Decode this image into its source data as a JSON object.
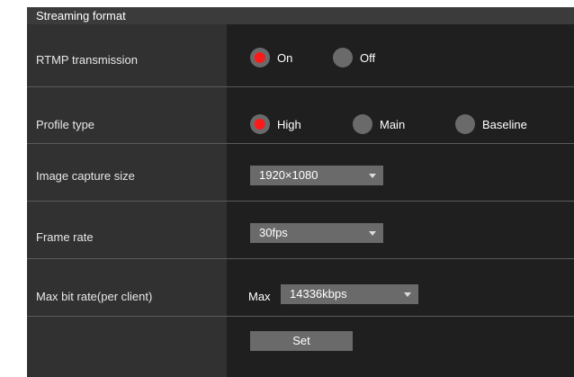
{
  "section": {
    "title": "Streaming format"
  },
  "rtmp": {
    "label": "RTMP transmission",
    "options": [
      {
        "label": "On",
        "selected": true
      },
      {
        "label": "Off",
        "selected": false
      }
    ]
  },
  "profile": {
    "label": "Profile type",
    "options": [
      {
        "label": "High",
        "selected": true
      },
      {
        "label": "Main",
        "selected": false
      },
      {
        "label": "Baseline",
        "selected": false
      }
    ]
  },
  "image_size": {
    "label": "Image capture size",
    "value": "1920×1080"
  },
  "frame_rate": {
    "label": "Frame rate",
    "value": "30fps"
  },
  "bitrate": {
    "label": "Max bit rate(per client)",
    "prefix": "Max",
    "value": "14336kbps"
  },
  "actions": {
    "set_label": "Set"
  },
  "colors": {
    "panel_bg": "#1f1f1f",
    "label_col_bg": "#313131",
    "header_bg": "#3b3b3b",
    "control_gray": "#6a6a6a",
    "radio_selected": "#ff1a1a"
  }
}
